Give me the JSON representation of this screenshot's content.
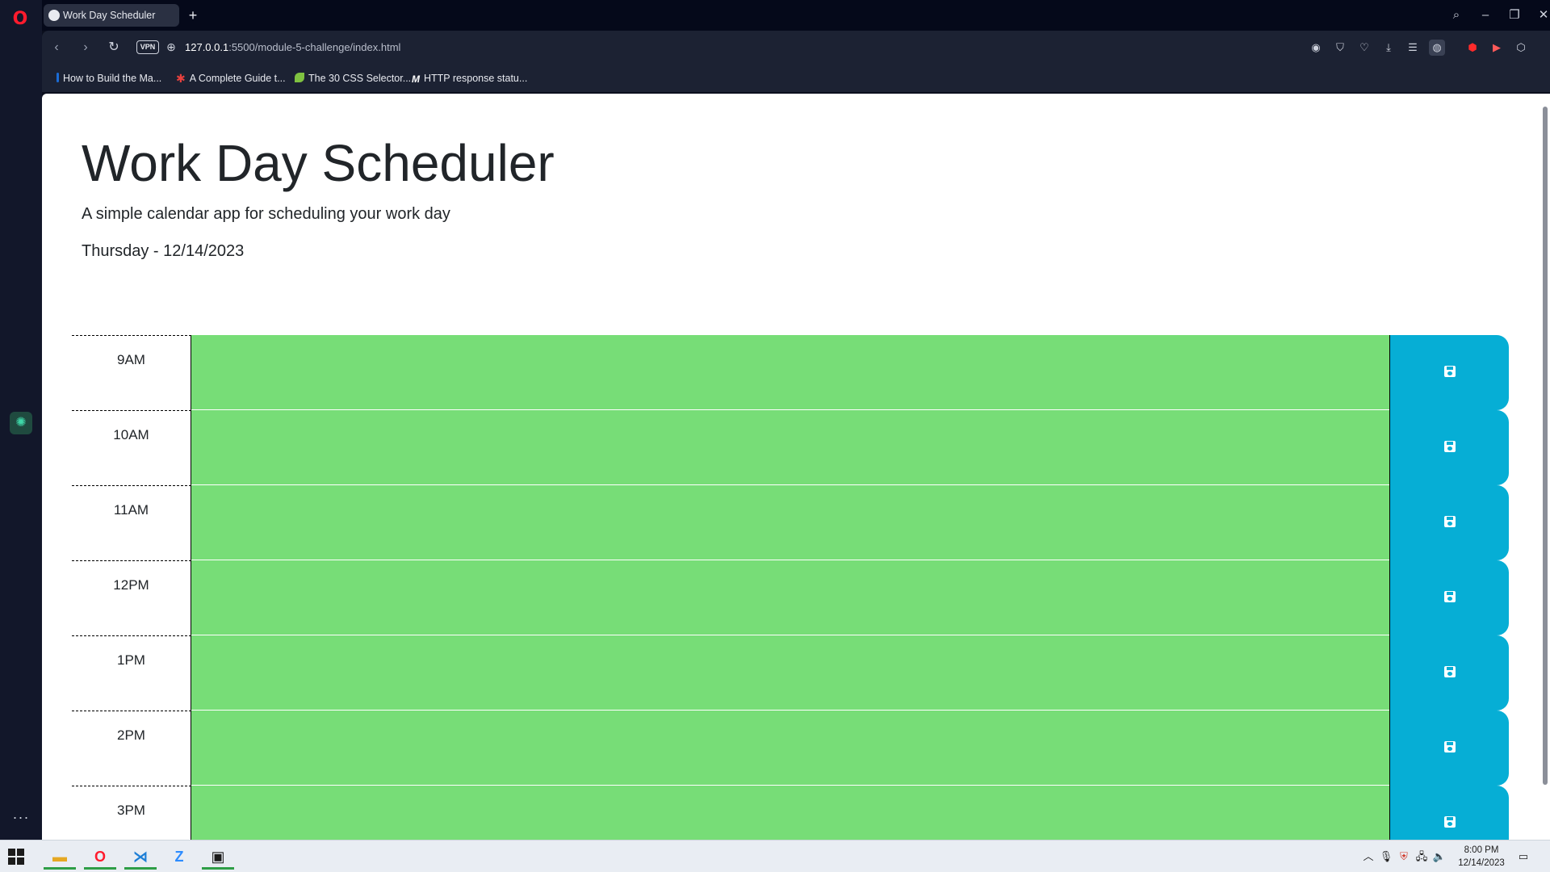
{
  "browser": {
    "tab_title": "Work Day Scheduler",
    "url_host": "127.0.0.1",
    "url_path": ":5500/module-5-challenge/index.html",
    "vpn_label": "VPN",
    "bookmarks": [
      {
        "label": "How to Build the Ma...",
        "icon": "bookmark-icon",
        "color": "#1b6cd6"
      },
      {
        "label": "A Complete Guide t...",
        "icon": "asterisk-icon",
        "color": "#e8413e"
      },
      {
        "label": "The 30 CSS Selector...",
        "icon": "leaf-icon",
        "color": "#7fc241"
      },
      {
        "label": "HTTP response statu...",
        "icon": "mdn-icon",
        "color": "#ffffff"
      }
    ]
  },
  "header": {
    "title": "Work Day Scheduler",
    "lead": "A simple calendar app for scheduling your work day",
    "current_day": "Thursday - 12/14/2023"
  },
  "schedule": {
    "colors": {
      "future": "#77dd77",
      "save": "#06aed5"
    },
    "rows": [
      {
        "hour": "9AM",
        "text": ""
      },
      {
        "hour": "10AM",
        "text": ""
      },
      {
        "hour": "11AM",
        "text": ""
      },
      {
        "hour": "12PM",
        "text": ""
      },
      {
        "hour": "1PM",
        "text": ""
      },
      {
        "hour": "2PM",
        "text": ""
      },
      {
        "hour": "3PM",
        "text": ""
      }
    ]
  },
  "taskbar": {
    "time": "8:00 PM",
    "date": "12/14/2023"
  }
}
